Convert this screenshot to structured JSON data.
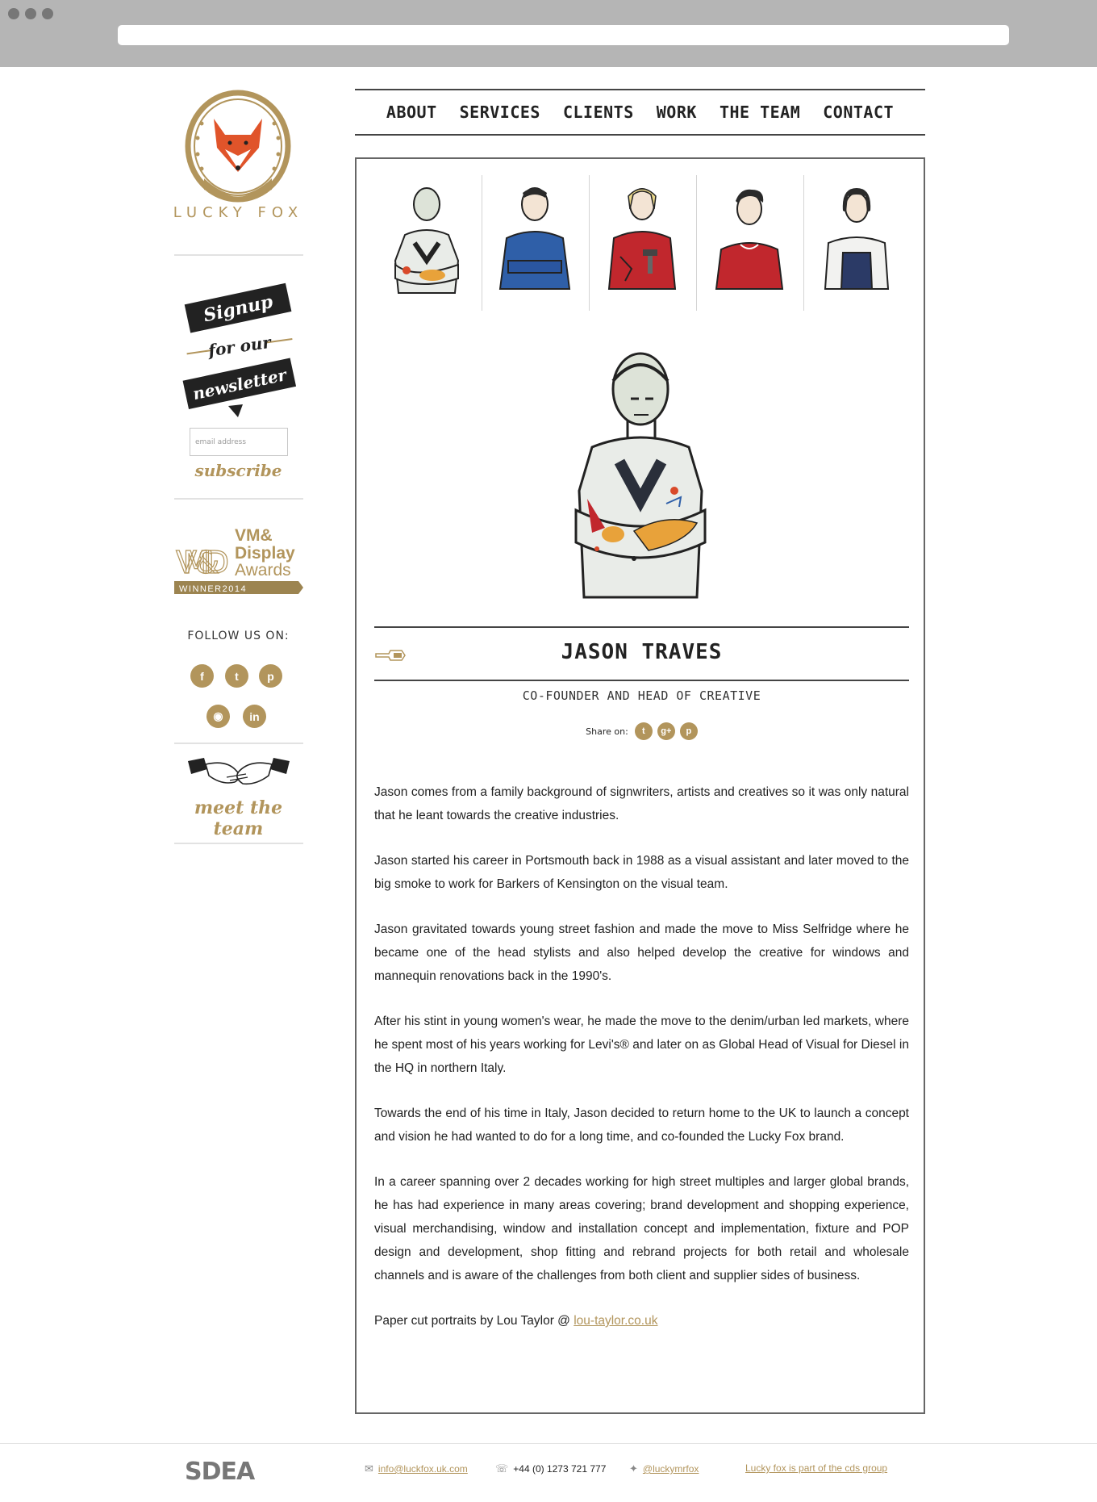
{
  "nav": {
    "items": [
      "ABOUT",
      "SERVICES",
      "CLIENTS",
      "WORK",
      "THE TEAM",
      "CONTACT"
    ]
  },
  "sidebar": {
    "brand": "LUCKY FOX",
    "newsletter_banner": [
      "Signup",
      "for our",
      "newsletter"
    ],
    "email_placeholder": "email address",
    "subscribe_label": "subscribe",
    "award": {
      "logo_text": "VM&D",
      "title_lines": [
        "VM&",
        "Display",
        "Awards"
      ],
      "ribbon": "WINNER2014"
    },
    "follow_label": "FOLLOW US ON:",
    "social_icons": [
      "facebook-icon",
      "twitter-icon",
      "pinterest-icon",
      "instagram-icon",
      "linkedin-icon"
    ],
    "meet_label": "meet the team"
  },
  "team": {
    "members": [
      "jason",
      "member-2",
      "member-3",
      "member-4",
      "member-5"
    ]
  },
  "profile": {
    "name": "JASON TRAVES",
    "role": "CO-FOUNDER AND HEAD OF CREATIVE",
    "share_label": "Share on:",
    "share_icons": [
      "twitter-icon",
      "google-plus-icon",
      "pinterest-icon"
    ],
    "bio": [
      "Jason comes from a family background of signwriters, artists and creatives so it was only natural that he leant towards the creative industries.",
      "Jason started his career in Portsmouth back in 1988 as a visual assistant and later moved to the big smoke to work for Barkers of Kensington on the visual team.",
      "Jason gravitated towards young street fashion and made the move to Miss Selfridge where he became one of the head stylists and also helped develop the creative for windows and mannequin renovations back in the 1990's.",
      "After his stint in young women's wear, he made the move to the denim/urban led markets, where he spent most of his years working for Levi's® and later on as Global Head of Visual for Diesel in the HQ in northern Italy.",
      "Towards the end of his time in Italy, Jason decided to return home to the UK to launch a concept and vision he had wanted to do for a long time, and co-founded the Lucky Fox brand.",
      "In a career spanning over 2 decades working for high street multiples and larger global brands, he has had experience in many areas covering; brand development and shopping experience, visual merchandising, window and installation concept and implementation, fixture and POP design and development, shop fitting and rebrand projects for both retail and wholesale channels and is aware of the challenges from both client and supplier sides of business."
    ],
    "credit_text": "Paper cut portraits by Lou Taylor @ ",
    "credit_link": "lou-taylor.co.uk"
  },
  "footer": {
    "logo": "SDEA",
    "email": "info@luckfox.uk.com",
    "phone": "+44 (0) 1273 721 777",
    "twitter": "@luckymrfox",
    "group": "Lucky fox is part of the cds group"
  },
  "colors": {
    "accent": "#b2955c",
    "fox": "#e0542a",
    "chrome": "#b5b5b5"
  }
}
